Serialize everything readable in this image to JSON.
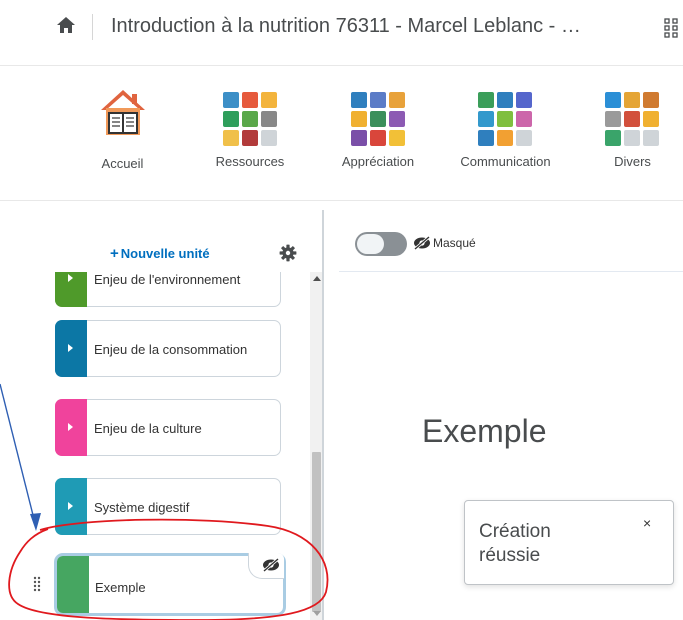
{
  "header": {
    "course_title": "Introduction à la nutrition 76311 - Marcel Leblanc - …",
    "home_icon": "home-icon",
    "apps_icon": "grid-icon"
  },
  "navbar": {
    "items": [
      {
        "label": "Accueil",
        "icon": "home-book-icon"
      },
      {
        "label": "Ressources",
        "icon": "resources-tiles-icon",
        "tiles": [
          "#3c8fc7",
          "#e65a3c",
          "#f3b43c",
          "#2e9e5b",
          "#5aa84a",
          "#888888",
          "#f0c04a",
          "#b23b3b",
          "#cfd4d8"
        ]
      },
      {
        "label": "Appréciation",
        "icon": "assessment-tiles-icon",
        "tiles": [
          "#2f7fbe",
          "#5b7cc7",
          "#e8a23a",
          "#f0b030",
          "#3b8f5b",
          "#8c5ab3",
          "#7a4fa8",
          "#d9463b",
          "#f2c037"
        ]
      },
      {
        "label": "Communication",
        "icon": "communication-tiles-icon",
        "tiles": [
          "#3b9e5a",
          "#2f7fbe",
          "#5566cc",
          "#3399cc",
          "#7fbf3f",
          "#cc66aa",
          "#2f7fbe",
          "#f2a032",
          "#cfd4d8"
        ]
      },
      {
        "label": "Divers",
        "icon": "misc-tiles-icon",
        "tiles": [
          "#2b8fd6",
          "#e5a536",
          "#d07a30",
          "#9a9a9a",
          "#d2503c",
          "#f0b030",
          "#3aa46a",
          "#cfd4d8",
          "#cfd4d8"
        ]
      }
    ]
  },
  "left_panel": {
    "new_unit_label": "Nouvelle unité",
    "new_unit_plus": "+",
    "units": [
      {
        "name": "Enjeu de l'environnement",
        "color": "#4f9a2a"
      },
      {
        "name": "Enjeu de la consommation",
        "color": "#0c77a5"
      },
      {
        "name": "Enjeu de la culture",
        "color": "#f0439c"
      },
      {
        "name": "Système digestif",
        "color": "#1f9bb5"
      },
      {
        "name": "Exemple",
        "color": "#46a661",
        "selected": true
      }
    ]
  },
  "right_panel": {
    "hidden_label": "Masqué",
    "unit_title": "Exemple"
  },
  "toast": {
    "message": "Création réussie",
    "close": "×"
  },
  "colors": {
    "accent_link": "#006fbf",
    "annotation_ellipse": "#e0191e",
    "annotation_arrow": "#2f5fb3",
    "selected_border": "#a9cce3"
  }
}
